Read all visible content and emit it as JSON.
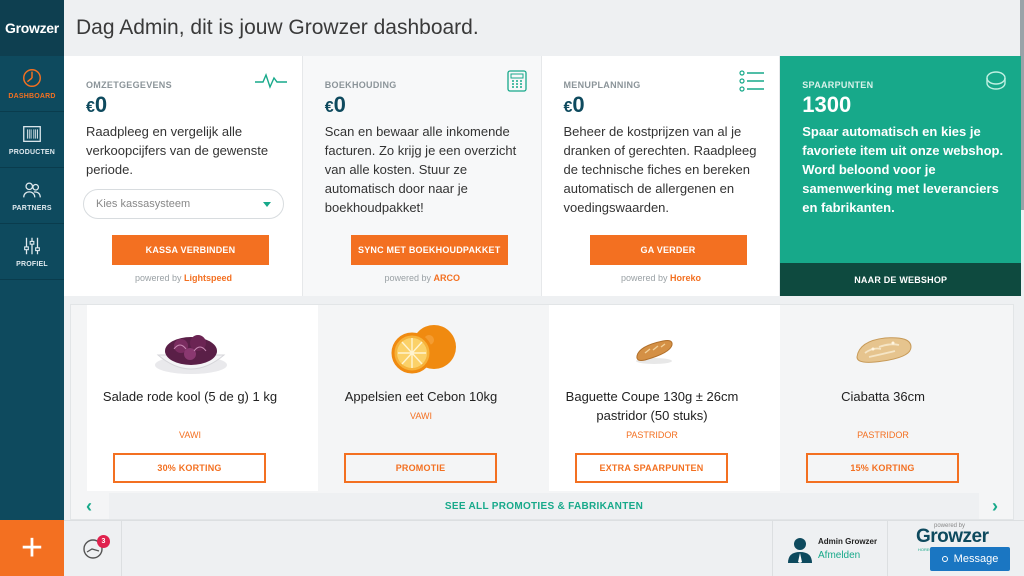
{
  "app": {
    "logo": "Growzer",
    "title": "Dag Admin, dit is jouw Growzer dashboard."
  },
  "sidebar": {
    "items": [
      {
        "label": "DASHBOARD",
        "icon": "clock-icon",
        "active": true
      },
      {
        "label": "PRODUCTEN",
        "icon": "barcode-icon",
        "active": false
      },
      {
        "label": "PARTNERS",
        "icon": "partners-icon",
        "active": false
      },
      {
        "label": "PROFIEL",
        "icon": "sliders-icon",
        "active": false
      }
    ],
    "add_label": "+"
  },
  "cards": [
    {
      "title": "OMZETGEGEVENS",
      "currency": "€",
      "value": "0",
      "desc": "Raadpleeg en vergelijk alle verkoopcijfers van de gewenste periode.",
      "select_placeholder": "Kies kassasysteem",
      "button": "KASSA VERBINDEN",
      "powered_prefix": "powered by",
      "powered_brand": "Lightspeed",
      "icon": "pulse-icon"
    },
    {
      "title": "BOEKHOUDING",
      "currency": "€",
      "value": "0",
      "desc": "Scan en bewaar alle inkomende facturen. Zo krijg je een overzicht van alle kosten. Stuur ze automatisch door naar je boekhoudpakket!",
      "button": "SYNC MET BOEKHOUDPAKKET",
      "powered_prefix": "powered by",
      "powered_brand": "ARCO",
      "icon": "calculator-icon"
    },
    {
      "title": "MENUPLANNING",
      "currency": "€",
      "value": "0",
      "desc": "Beheer de kostprijzen van al je dranken of gerechten. Raadpleeg de technische fiches en bereken automatisch de allergenen en voedingswaarden.",
      "button": "GA VERDER",
      "powered_prefix": "powered by",
      "powered_brand": "Horeko",
      "icon": "list-icon"
    },
    {
      "title": "SPAARPUNTEN",
      "value": "1300",
      "desc": "Spaar automatisch en kies je favoriete item uit onze webshop. Word beloond voor je samenwerking met leveranciers en fabrikanten.",
      "button": "NAAR DE WEBSHOP",
      "icon": "coins-icon"
    }
  ],
  "promotions": {
    "products": [
      {
        "name": "Salade rode kool (5 de g) 1 kg",
        "brand": "VAWI",
        "button": "30% KORTING",
        "image": "red-cabbage-image"
      },
      {
        "name": "Appelsien eet Cebon 10kg",
        "brand": "VAWI",
        "button": "PROMOTIE",
        "image": "orange-image"
      },
      {
        "name": "Baguette Coupe 130g ± 26cm pastridor (50 stuks)",
        "brand": "PASTRIDOR",
        "button": "EXTRA SPAARPUNTEN",
        "image": "baguette-image"
      },
      {
        "name": "Ciabatta 36cm",
        "brand": "PASTRIDOR",
        "button": "15% KORTING",
        "image": "ciabatta-image"
      }
    ],
    "see_all": "SEE ALL PROMOTIES & FABRIKANTEN",
    "prev": "‹",
    "next": "›"
  },
  "bottom": {
    "notification_count": "3",
    "user_name": "Admin Growzer",
    "logout": "Afmelden",
    "brand_powered": "powered by",
    "brand_name": "Growzer",
    "brand_tagline": "HORECA MANAGEMENT PLATFORM",
    "message_button": "Message"
  },
  "colors": {
    "accent": "#f37021",
    "teal": "#17a98a",
    "navy": "#0e4a5e",
    "dark_green": "#0e4a3f",
    "message_blue": "#1a76c2"
  }
}
